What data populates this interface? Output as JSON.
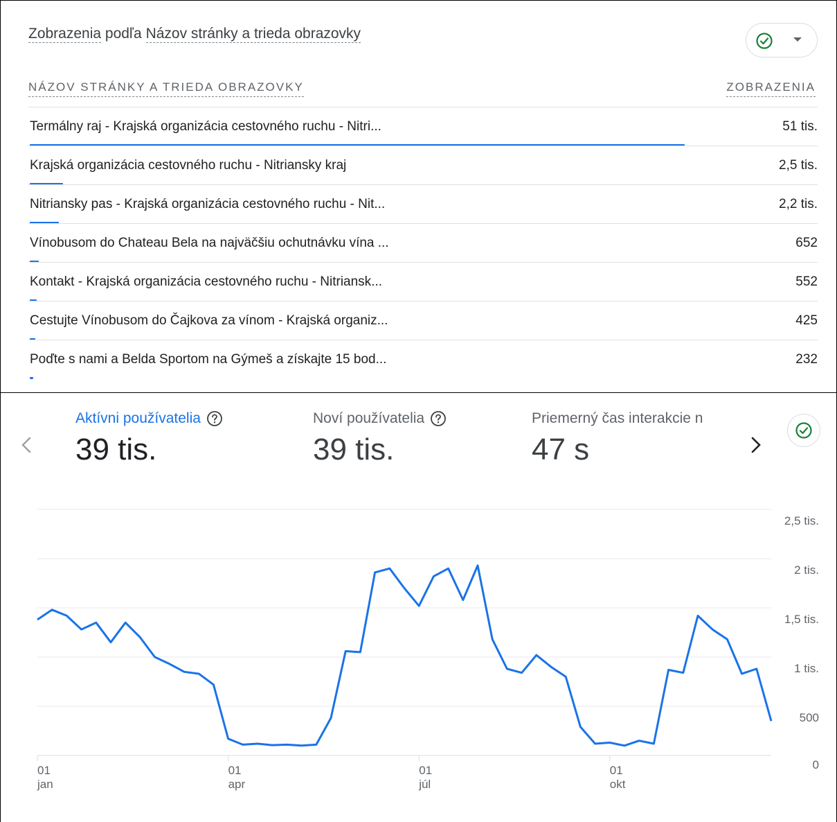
{
  "table_card": {
    "title_prefix": "Zobrazenia",
    "title_mid": " podľa ",
    "title_dim": "Názov stránky a trieda obrazovky",
    "col_left": "NÁZOV STRÁNKY A TRIEDA OBRAZOVKY",
    "col_right": "ZOBRAZENIA",
    "rows": [
      {
        "name": "Termálny raj - Krajská organizácia cestovného ruchu - Nitri...",
        "value": "51 tis.",
        "share": 0.83
      },
      {
        "name": "Krajská organizácia cestovného ruchu - Nitriansky kraj",
        "value": "2,5 tis.",
        "share": 0.042
      },
      {
        "name": "Nitriansky pas - Krajská organizácia cestovného ruchu - Nit...",
        "value": "2,2 tis.",
        "share": 0.037
      },
      {
        "name": "Vínobusom do Chateau Bela na najväčšiu ochutnávku vína ...",
        "value": "652",
        "share": 0.011
      },
      {
        "name": "Kontakt - Krajská organizácia cestovného ruchu - Nitriansk...",
        "value": "552",
        "share": 0.009
      },
      {
        "name": "Cestujte Vínobusom do Čajkova za vínom - Krajská organiz...",
        "value": "425",
        "share": 0.007
      },
      {
        "name": "Poďte s nami a Belda Sportom na Gýmeš a získajte 15 bod...",
        "value": "232",
        "share": 0.004
      }
    ],
    "accent": "#1a73e8"
  },
  "metrics": [
    {
      "label": "Aktívni používatelia",
      "value": "39 tis.",
      "active": true
    },
    {
      "label": "Noví používatelia",
      "value": "39 tis.",
      "active": false
    },
    {
      "label": "Priemerný čas interakcie n",
      "value": "47 s",
      "active": false
    }
  ],
  "chart_data": {
    "type": "line",
    "series": [
      {
        "values": [
          1380,
          1480,
          1420,
          1280,
          1350,
          1150,
          1350,
          1200,
          1000,
          930,
          850,
          830,
          720,
          170,
          110,
          120,
          105,
          110,
          100,
          110,
          380,
          1060,
          1050,
          1860,
          1900,
          1700,
          1520,
          1820,
          1900,
          1580,
          1930,
          1180,
          880,
          840,
          1020,
          900,
          800,
          290,
          120,
          130,
          100,
          150,
          120,
          870,
          840,
          1420,
          1280,
          1180,
          830,
          880,
          350
        ],
        "color": "#1a73e8"
      }
    ],
    "x_ticks": [
      {
        "day": "01",
        "month": "jan",
        "index": 0
      },
      {
        "day": "01",
        "month": "apr",
        "index": 13
      },
      {
        "day": "01",
        "month": "júl",
        "index": 26
      },
      {
        "day": "01",
        "month": "okt",
        "index": 39
      }
    ],
    "y_ticks": [
      "2,5 tis.",
      "2 tis.",
      "1,5 tis.",
      "1 tis.",
      "500",
      "0"
    ],
    "y_tick_values": [
      2500,
      2000,
      1500,
      1000,
      500,
      0
    ],
    "ylim": [
      0,
      2500
    ],
    "grid": true
  }
}
